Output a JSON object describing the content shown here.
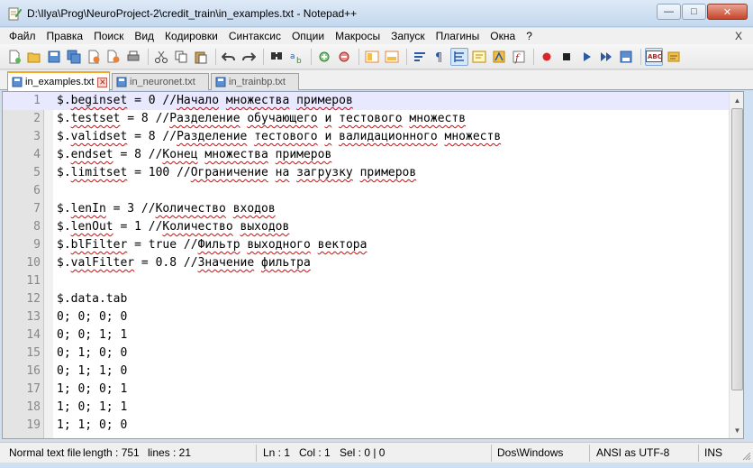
{
  "window": {
    "title": "D:\\Ilya\\Prog\\NeuroProject-2\\credit_train\\in_examples.txt - Notepad++",
    "minimize": "—",
    "maximize": "□",
    "close": "✕"
  },
  "menu": {
    "items": [
      "Файл",
      "Правка",
      "Поиск",
      "Вид",
      "Кодировки",
      "Синтаксис",
      "Опции",
      "Макросы",
      "Запуск",
      "Плагины",
      "Окна",
      "?"
    ],
    "close_doc": "X"
  },
  "toolbar": {
    "icons": [
      "new-file-icon",
      "open-file-icon",
      "save-icon",
      "save-all-icon",
      "close-icon",
      "close-all-icon",
      "print-icon",
      "cut-icon",
      "copy-icon",
      "paste-icon",
      "undo-icon",
      "redo-icon",
      "find-icon",
      "replace-icon",
      "zoom-in-icon",
      "zoom-out-icon",
      "sync-v-icon",
      "sync-h-icon",
      "word-wrap-icon",
      "show-all-chars-icon",
      "indent-guide-icon",
      "udl-icon",
      "doc-map-icon",
      "function-list-icon",
      "record-macro-icon",
      "stop-macro-icon",
      "play-macro-icon",
      "run-macro-multiple-icon",
      "save-macro-icon",
      "spellcheck-icon",
      "spellcheck-options-icon"
    ]
  },
  "tabs": [
    {
      "label": "in_examples.txt",
      "active": true
    },
    {
      "label": "in_neuronet.txt",
      "active": false
    },
    {
      "label": "in_trainbp.txt",
      "active": false
    }
  ],
  "editor": {
    "current_line": 1,
    "lines": [
      {
        "num": "1",
        "text": "$.beginset = 0 //Начало множества примеров"
      },
      {
        "num": "2",
        "text": "$.testset = 8 //Разделение обучающего и тестового множеств"
      },
      {
        "num": "3",
        "text": "$.validset = 8 //Разделение тестового и валидационного множеств"
      },
      {
        "num": "4",
        "text": "$.endset = 8 //Конец множества примеров"
      },
      {
        "num": "5",
        "text": "$.limitset = 100 //Ограничение на загрузку примеров"
      },
      {
        "num": "6",
        "text": ""
      },
      {
        "num": "7",
        "text": "$.lenIn = 3 //Количество входов"
      },
      {
        "num": "8",
        "text": "$.lenOut = 1 //Количество выходов"
      },
      {
        "num": "9",
        "text": "$.blFilter = true //Фильтр выходного вектора"
      },
      {
        "num": "10",
        "text": "$.valFilter = 0.8 //Значение фильтра"
      },
      {
        "num": "11",
        "text": ""
      },
      {
        "num": "12",
        "text": "$.data.tab"
      },
      {
        "num": "13",
        "text": "0; 0; 0; 0"
      },
      {
        "num": "14",
        "text": "0; 0; 1; 1"
      },
      {
        "num": "15",
        "text": "0; 1; 0; 0"
      },
      {
        "num": "16",
        "text": "0; 1; 1; 0"
      },
      {
        "num": "17",
        "text": "1; 0; 0; 1"
      },
      {
        "num": "18",
        "text": "1; 0; 1; 1"
      },
      {
        "num": "19",
        "text": "1; 1; 0; 0"
      }
    ]
  },
  "statusbar": {
    "file_type": "Normal text file",
    "length": "length : 751",
    "lines": "lines : 21",
    "ln": "Ln : 1",
    "col": "Col : 1",
    "sel": "Sel : 0 | 0",
    "eol": "Dos\\Windows",
    "encoding": "ANSI as UTF-8",
    "mode": "INS"
  }
}
